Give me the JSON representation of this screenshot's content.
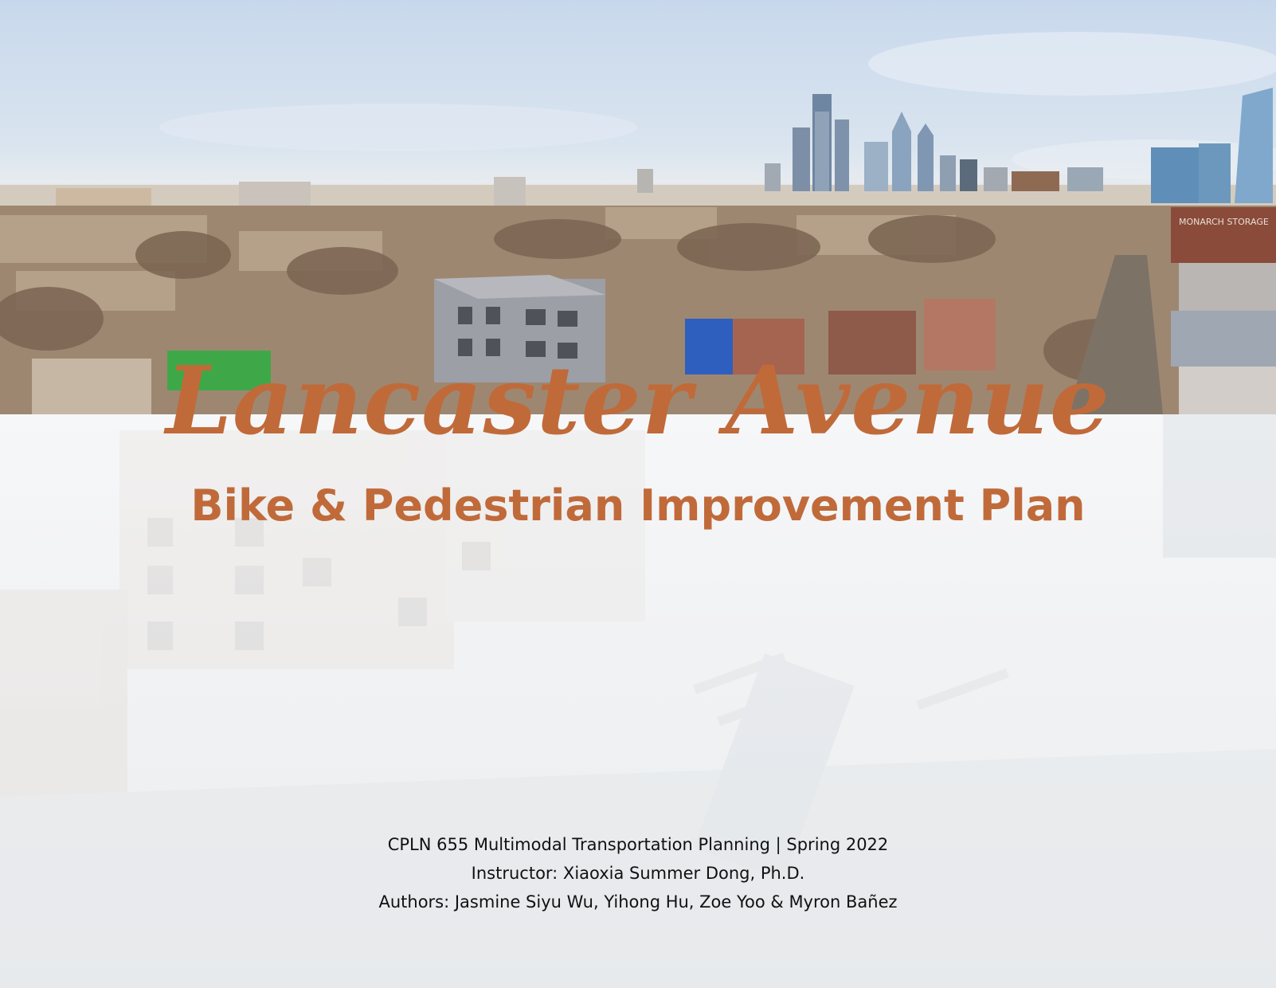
{
  "cover": {
    "title": "Lancaster Avenue",
    "subtitle": "Bike & Pedestrian Improvement Plan",
    "course_line": "CPLN 655 Multimodal Transportation Planning | Spring 2022",
    "instructor_line": "Instructor: Xiaoxia Summer Dong, Ph.D.",
    "authors_line": "Authors: Jasmine Siyu Wu, Yihong Hu, Zoe Yoo & Myron Bañez",
    "building_sign": "MONARCH STORAGE"
  },
  "colors": {
    "title": "#c06a3a",
    "credits_text": "#111111",
    "sky": "#c8d8ec"
  }
}
